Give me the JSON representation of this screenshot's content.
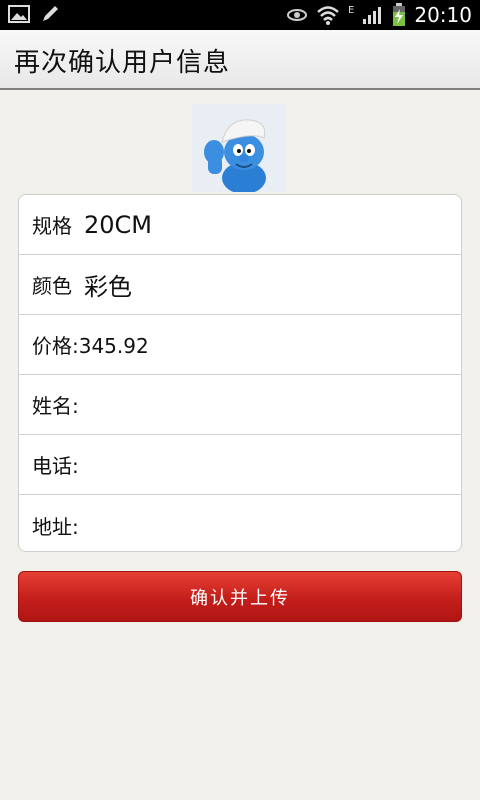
{
  "status_bar": {
    "time": "20:10",
    "network_label": "E",
    "icons": [
      "image-icon",
      "pencil-icon",
      "eye-icon",
      "wifi-icon",
      "signal-icon",
      "battery-charging-icon"
    ]
  },
  "title_bar": {
    "title": "再次确认用户信息"
  },
  "product": {
    "image_alt": "smurf-image"
  },
  "form": {
    "spec": {
      "label": "规格",
      "value": "20CM"
    },
    "color": {
      "label": "颜色",
      "value": "彩色"
    },
    "price": {
      "text": "价格:345.92"
    },
    "name": {
      "label": "姓名:",
      "value": ""
    },
    "phone": {
      "label": "电话:",
      "value": ""
    },
    "address": {
      "label": "地址:",
      "value": ""
    }
  },
  "confirm_button": {
    "label": "确认并上传"
  },
  "colors": {
    "button_red": "#c41e1b",
    "background": "#f2f0eb",
    "status_bar": "#000000"
  }
}
